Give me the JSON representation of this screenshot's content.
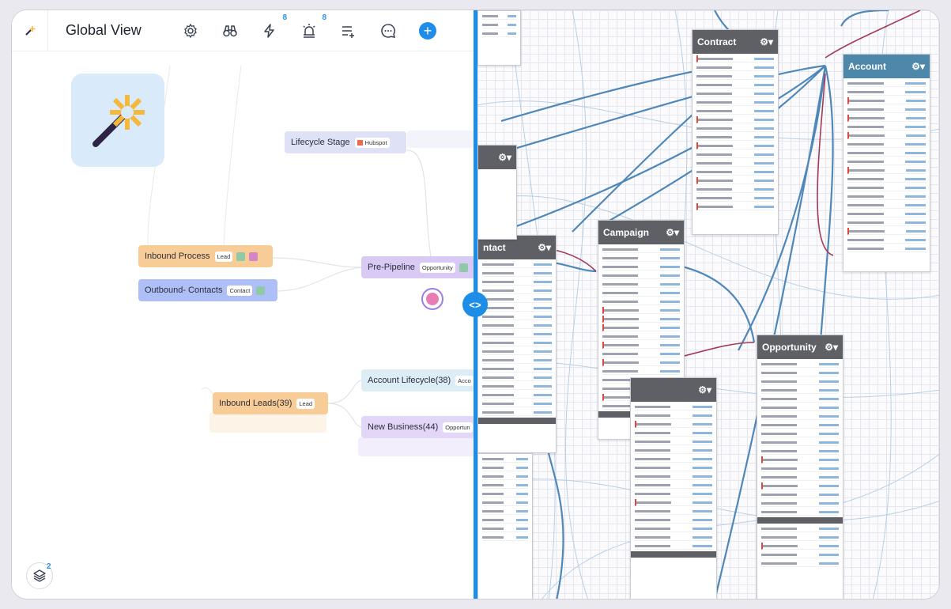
{
  "toolbar": {
    "title": "Global View",
    "zap_badge": "8",
    "alarm_badge": "8",
    "plus": "+"
  },
  "nodes": {
    "lifecycle": {
      "label": "Lifecycle Stage",
      "tag": "Hubspot"
    },
    "inbound_process": {
      "label": "Inbound Process",
      "tag": "Lead"
    },
    "outbound_contacts": {
      "label": "Outbound- Contacts",
      "tag": "Contact"
    },
    "pre_pipeline": {
      "label": "Pre-Pipeline",
      "tag": "Opportunity"
    },
    "inbound_leads": {
      "label": "Inbound Leads(39)",
      "tag": "Lead"
    },
    "account_lifecycle": {
      "label": "Account Lifecycle(38)",
      "tag": "Acco"
    },
    "new_business": {
      "label": "New Business(44)",
      "tag": "Opportun"
    }
  },
  "layers_badge": "2",
  "divider_handle": "<>",
  "entities": {
    "contract": "Contract",
    "account": "Account",
    "campaign": "Campaign",
    "opportunity": "Opportunity",
    "contact": "ntact"
  },
  "colors": {
    "accent": "#1e8de8",
    "inbound_process": "#f8cc97",
    "outbound_contacts": "#adbff6",
    "pre_pipeline": "#d8c9f5",
    "lifecycle": "#dfe1f7",
    "account_lifecycle": "#dcedf6",
    "new_business": "#e3d7f8",
    "inbound_leads": "#f8cc97",
    "entity_header": "#5e6066",
    "entity_header_blue": "#4d87aa",
    "link_blue": "#4f87b8",
    "link_red": "#a43a55"
  }
}
